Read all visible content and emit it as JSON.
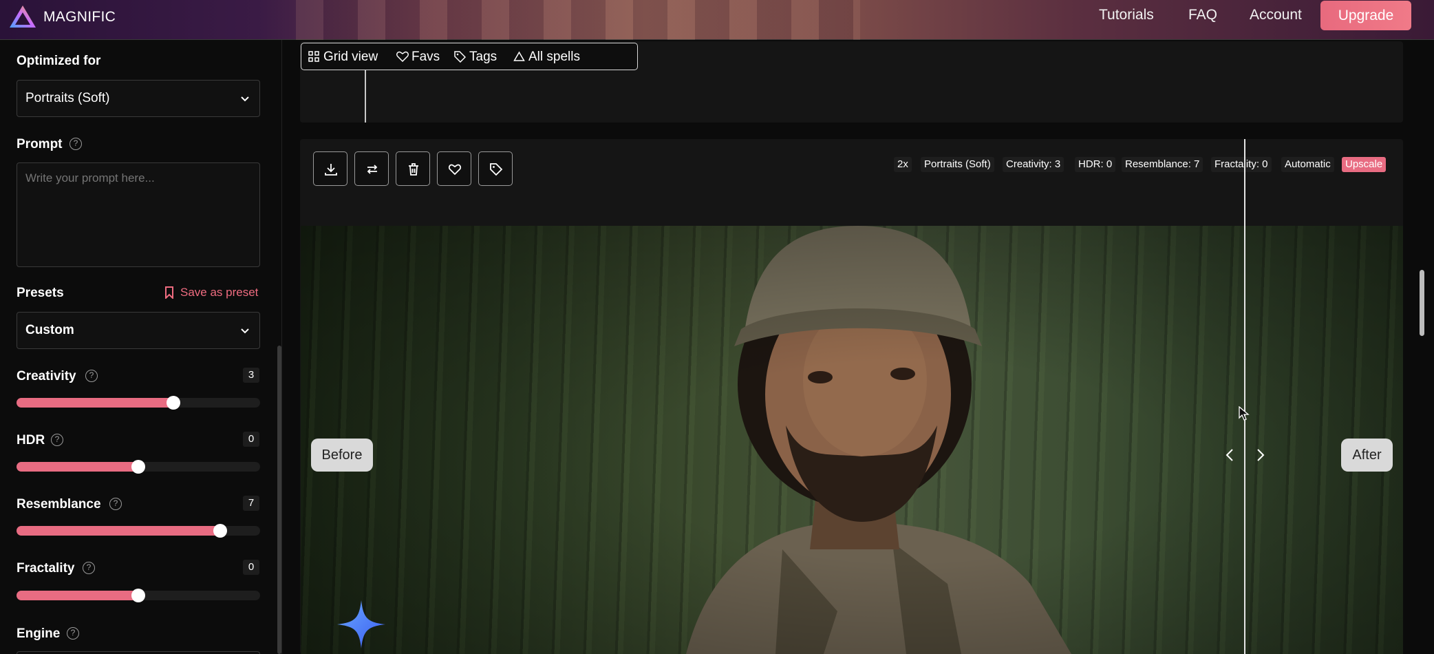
{
  "header": {
    "brand": "MAGNIFIC",
    "nav": [
      "Tutorials",
      "FAQ",
      "Account"
    ],
    "upgrade_label": "Upgrade"
  },
  "sidebar": {
    "optimized_for_label": "Optimized for",
    "optimized_for_value": "Portraits (Soft)",
    "prompt_label": "Prompt",
    "prompt_placeholder": "Write your prompt here...",
    "presets_label": "Presets",
    "save_preset_label": "Save as preset",
    "preset_value": "Custom",
    "sliders": [
      {
        "label": "Creativity",
        "value": "3",
        "fraction": 0.645
      },
      {
        "label": "HDR",
        "value": "0",
        "fraction": 0.5
      },
      {
        "label": "Resemblance",
        "value": "7",
        "fraction": 0.835
      },
      {
        "label": "Fractality",
        "value": "0",
        "fraction": 0.5
      }
    ],
    "engine_label": "Engine",
    "help_glyph": "?"
  },
  "viewbar": {
    "items": [
      "Grid view",
      "Favs",
      "Tags",
      "All spells"
    ]
  },
  "result": {
    "tags": [
      "2x",
      "Portraits (Soft)",
      "Creativity: 3",
      "HDR: 0",
      "Resemblance: 7",
      "Fractality: 0",
      "Automatic",
      "Upscale"
    ],
    "before_label": "Before",
    "after_label": "After"
  },
  "colors": {
    "accent": "#e86c82",
    "panel": "#151515"
  }
}
